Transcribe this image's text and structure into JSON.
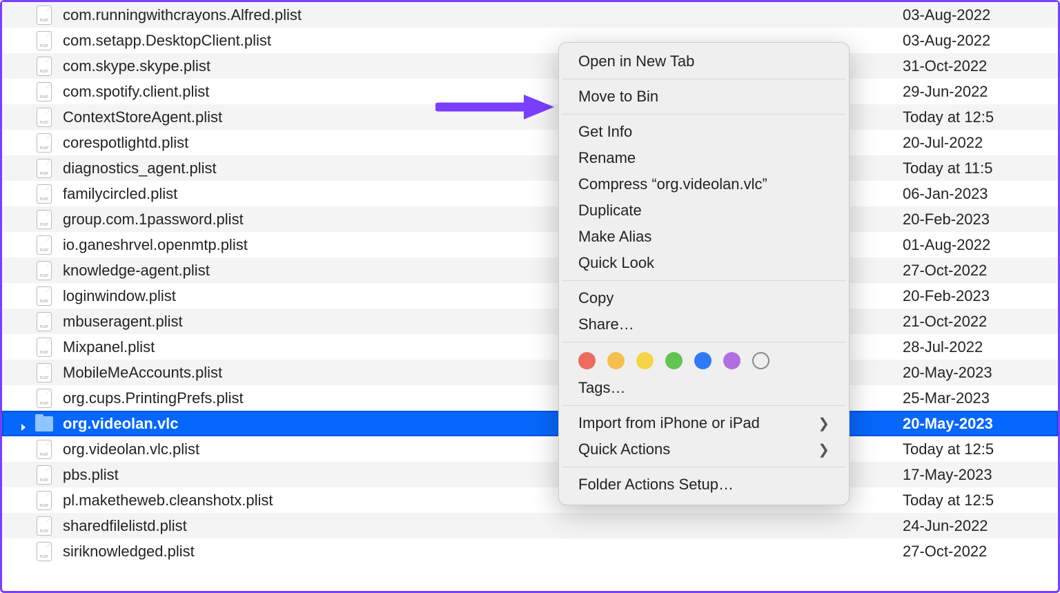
{
  "files": [
    {
      "name": "com.runningwithcrayons.Alfred.plist",
      "date": "03-Aug-2022",
      "type": "plist"
    },
    {
      "name": "com.setapp.DesktopClient.plist",
      "date": "03-Aug-2022",
      "type": "plist"
    },
    {
      "name": "com.skype.skype.plist",
      "date": "31-Oct-2022",
      "type": "plist"
    },
    {
      "name": "com.spotify.client.plist",
      "date": "29-Jun-2022",
      "type": "plist"
    },
    {
      "name": "ContextStoreAgent.plist",
      "date": "Today at 12:5",
      "type": "plist"
    },
    {
      "name": "corespotlightd.plist",
      "date": "20-Jul-2022",
      "type": "plist"
    },
    {
      "name": "diagnostics_agent.plist",
      "date": "Today at 11:5",
      "type": "plist"
    },
    {
      "name": "familycircled.plist",
      "date": "06-Jan-2023",
      "type": "plist"
    },
    {
      "name": "group.com.1password.plist",
      "date": "20-Feb-2023",
      "type": "plist"
    },
    {
      "name": "io.ganeshrvel.openmtp.plist",
      "date": "01-Aug-2022",
      "type": "plist"
    },
    {
      "name": "knowledge-agent.plist",
      "date": "27-Oct-2022",
      "type": "plist"
    },
    {
      "name": "loginwindow.plist",
      "date": "20-Feb-2023",
      "type": "plist"
    },
    {
      "name": "mbuseragent.plist",
      "date": "21-Oct-2022",
      "type": "plist"
    },
    {
      "name": "Mixpanel.plist",
      "date": "28-Jul-2022",
      "type": "plist"
    },
    {
      "name": "MobileMeAccounts.plist",
      "date": "20-May-2023",
      "type": "plist"
    },
    {
      "name": "org.cups.PrintingPrefs.plist",
      "date": "25-Mar-2023",
      "type": "plist"
    },
    {
      "name": "org.videolan.vlc",
      "date": "20-May-2023",
      "type": "folder",
      "selected": true
    },
    {
      "name": "org.videolan.vlc.plist",
      "date": "Today at 12:5",
      "type": "plist"
    },
    {
      "name": "pbs.plist",
      "date": "17-May-2023",
      "type": "plist"
    },
    {
      "name": "pl.maketheweb.cleanshotx.plist",
      "date": "Today at 12:5",
      "type": "plist"
    },
    {
      "name": "sharedfilelistd.plist",
      "date": "24-Jun-2022",
      "type": "plist"
    },
    {
      "name": "siriknowledged.plist",
      "date": "27-Oct-2022",
      "type": "plist"
    }
  ],
  "menu": {
    "open_new_tab": "Open in New Tab",
    "move_to_bin": "Move to Bin",
    "get_info": "Get Info",
    "rename": "Rename",
    "compress": "Compress “org.videolan.vlc”",
    "duplicate": "Duplicate",
    "make_alias": "Make Alias",
    "quick_look": "Quick Look",
    "copy": "Copy",
    "share": "Share…",
    "tags": "Tags…",
    "import_iphone": "Import from iPhone or iPad",
    "quick_actions": "Quick Actions",
    "folder_actions": "Folder Actions Setup…"
  },
  "tag_colors": [
    "#ec6a5e",
    "#f4bf4f",
    "#f5d547",
    "#61c453",
    "#2f7bf5",
    "#b06ee0"
  ],
  "annotation": {
    "arrow_color": "#7A3FFF"
  }
}
